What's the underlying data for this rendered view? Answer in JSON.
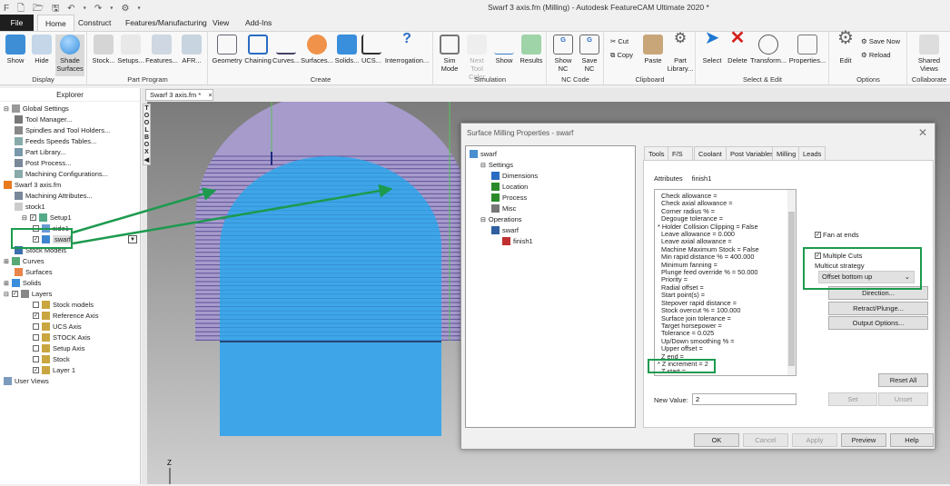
{
  "window": {
    "title": "Swarf 3 axis.fm (Milling) - Autodesk FeatureCAM Ultimate 2020 *",
    "quick_access": "F 🗋 🗁 🖫 ↶ ▾ ↷ ▾ ⚙ ▾"
  },
  "ribbon_tabs": [
    "File",
    "Home",
    "Construct",
    "Features/Manufacturing",
    "View",
    "Add-Ins"
  ],
  "ribbon_groups": [
    {
      "label": "Display",
      "buttons": [
        "Show",
        "Hide",
        "Shade Surfaces"
      ]
    },
    {
      "label": "Part Program",
      "buttons": [
        "Stock...",
        "Setups...",
        "Features...",
        "AFR..."
      ]
    },
    {
      "label": "Create",
      "buttons": [
        "Geometry",
        "Chaining",
        "Curves...",
        "Surfaces...",
        "Solids...",
        "UCS...",
        "Interrogation..."
      ]
    },
    {
      "label": "Simulation",
      "buttons": [
        "Sim Mode",
        "Next Tool Color",
        "Show",
        "Results"
      ]
    },
    {
      "label": "NC Code",
      "buttons": [
        "Show NC",
        "Save NC"
      ]
    },
    {
      "label": "Clipboard",
      "buttons": [
        "Cut",
        "Copy",
        "Paste",
        "Part Library..."
      ]
    },
    {
      "label": "Select & Edit",
      "buttons": [
        "Select",
        "Delete",
        "Transform...",
        "Properties..."
      ]
    },
    {
      "label": "Options",
      "buttons": [
        "Edit",
        "Save Now",
        "Reload"
      ]
    },
    {
      "label": "Collaborate",
      "buttons": [
        "Shared Views"
      ]
    }
  ],
  "explorer": {
    "title": "Explorer",
    "items": [
      "Global Settings",
      "Tool Manager...",
      "Spindles and Tool Holders...",
      "Feeds  Speeds Tables...",
      "Part Library...",
      "Post Process...",
      "Machining Configurations...",
      "Swarf 3 axis.fm",
      "Machining Attributes...",
      "stock1",
      "Setup1",
      "side1",
      "swarf",
      "Stock Models",
      "Curves",
      "Surfaces",
      "Solids",
      "Layers",
      "Stock models",
      "Reference Axis",
      "UCS Axis",
      "STOCK Axis",
      "Setup Axis",
      "Stock",
      "Layer 1",
      "User Views"
    ]
  },
  "viewport": {
    "tab": "Swarf 3 axis.fm *",
    "tab_close": "×",
    "toolbox": "TOOLBOX",
    "axis_label": "Z"
  },
  "dialog": {
    "title": "Surface Milling Properties - swarf",
    "close": "✕",
    "tree": [
      "swarf",
      "Settings",
      "Dimensions",
      "Location",
      "Process",
      "Misc",
      "Operations",
      "swarf",
      "finish1"
    ],
    "tabs": [
      "Tools",
      "F/S",
      "Coolant",
      "Post Variables",
      "Milling",
      "Leads"
    ],
    "active_tab": "Milling",
    "attributes_label": "Attributes",
    "attributes_op": "finish1",
    "attributes": [
      "Check allowance =",
      "Check axial allowance =",
      "Corner radius % =",
      "Degouge tolerance =",
      "* Holder Collision Clipping = False",
      "Leave allowance = 0.000",
      "Leave axial allowance =",
      "Machine Maximum Stock = False",
      "Min rapid distance % = 400.000",
      "Minimum fanning =",
      "Plunge feed override % = 50.000",
      "Priority =",
      "Radial offset =",
      "Start point(s) =",
      "Stepover rapid distance =",
      "Stock overcut % = 100.000",
      "Surface join tolerance =",
      "Target horsepower =",
      "Tolerance = 0.025",
      "Up/Down smoothing % =",
      "Upper offset =",
      "Z end =",
      "* Z increment = 2",
      "Z start ="
    ],
    "new_value_label": "New Value:",
    "new_value": "2",
    "fan_at_ends": "Fan at ends",
    "multiple_cuts": "Multiple Cuts",
    "multicut_label": "Multicut strategy",
    "multicut_value": "Offset bottom up",
    "buttons": {
      "direction": "Direction...",
      "retract": "Retract/Plunge...",
      "output": "Output Options...",
      "reset": "Reset All",
      "set": "Set",
      "unset": "Unset",
      "ok": "OK",
      "cancel": "Cancel",
      "apply": "Apply",
      "preview": "Preview",
      "help": "Help"
    }
  },
  "colors": {
    "annotation": "#1c9a4e",
    "part_blue": "#3ea6e8",
    "stock_purple": "#9a8fc4"
  }
}
